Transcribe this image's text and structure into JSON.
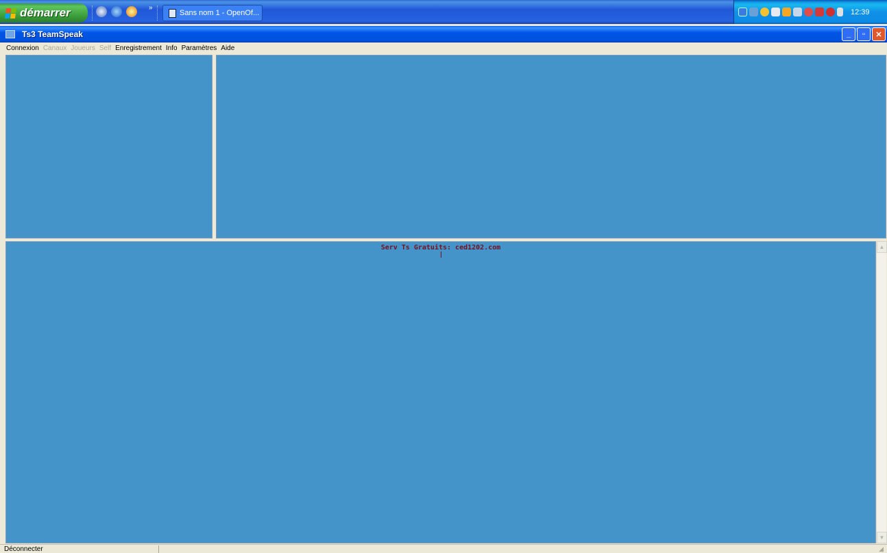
{
  "taskbar": {
    "start_label": "démarrer",
    "chevron": "»",
    "task_button_label": "Sans nom 1 - OpenOf...",
    "clock": "12:39",
    "quick_launch": [
      "show-desktop-icon",
      "internet-explorer-icon",
      "media-player-icon"
    ],
    "tray_icons": [
      "network-icon",
      "shield-icon",
      "msn-icon",
      "bluetooth-icon",
      "display-icon",
      "antivirus-icon",
      "sync-icon",
      "remote-icon",
      "update-icon",
      "pen-icon"
    ]
  },
  "window": {
    "title": "Ts3 TeamSpeak",
    "minimize_glyph": "_",
    "restore_glyph": "▫",
    "close_glyph": "✕"
  },
  "menu": {
    "items": [
      {
        "label": "Connexion",
        "enabled": true
      },
      {
        "label": "Canaux",
        "enabled": false
      },
      {
        "label": "Joueurs",
        "enabled": false
      },
      {
        "label": "Self",
        "enabled": false
      },
      {
        "label": "Enregistrement",
        "enabled": true
      },
      {
        "label": "Info",
        "enabled": true
      },
      {
        "label": "Paramètres",
        "enabled": true
      },
      {
        "label": "Aide",
        "enabled": true
      }
    ]
  },
  "chat": {
    "banner": "Serv Ts Gratuits: ced1202.com"
  },
  "status": {
    "text": "Déconnecter"
  },
  "colors": {
    "pane_bg": "#4493c9",
    "banner_text": "#7a0f1d",
    "titlebar": "#0055e5"
  }
}
